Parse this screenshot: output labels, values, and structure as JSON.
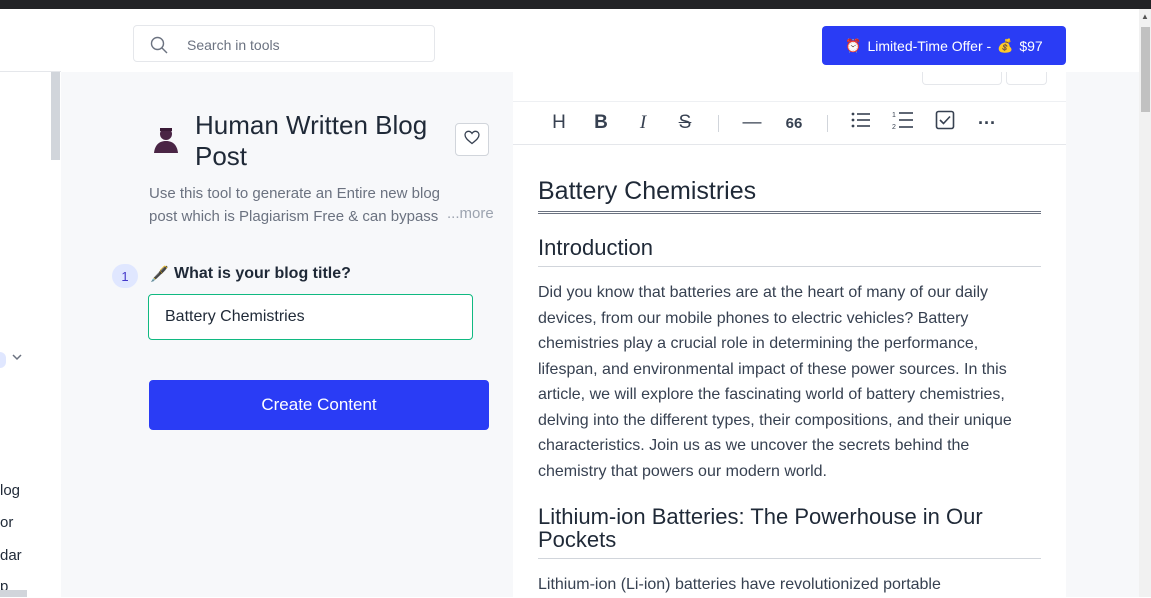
{
  "header": {
    "search_placeholder": "Search in tools",
    "offer_label": "Limited-Time Offer -",
    "offer_price": "$97",
    "offer_icon_alarm": "⏰",
    "offer_icon_moneybag": "💰"
  },
  "sidebar": {
    "partial_items": [
      "log",
      "or",
      "dar",
      "p"
    ]
  },
  "tool": {
    "title": "Human Written Blog Post",
    "description": "Use this tool to generate an Entire new blog post which is Plagiarism Free & can bypass",
    "more_label": "...more"
  },
  "form": {
    "step_number": "1",
    "step_icon": "🖋️",
    "step_label": "What is your blog title?",
    "title_value": "Battery Chemistries",
    "create_button": "Create Content"
  },
  "editor": {
    "toolbar": [
      "heading",
      "bold",
      "italic",
      "strikethrough",
      "horizontal-rule",
      "blockquote",
      "bullet-list",
      "numbered-list",
      "checklist",
      "more"
    ],
    "toolbar_glyphs": {
      "heading": "H",
      "bold": "B",
      "italic": "I",
      "strikethrough": "S",
      "horizontal_rule": "—",
      "blockquote": "66",
      "more": "···"
    },
    "doc_title": "Battery Chemistries",
    "section1_heading": "Introduction",
    "section1_text": "Did you know that batteries are at the heart of many of our daily devices, from our mobile phones to electric vehicles? Battery chemistries play a crucial role in determining the performance, lifespan, and environmental impact of these power sources. In this article, we will explore the fascinating world of battery chemistries, delving into the different types, their compositions, and their unique characteristics. Join us as we uncover the secrets behind the chemistry that powers our modern world.",
    "section2_heading": "Lithium-ion Batteries: The Powerhouse in Our Pockets",
    "section2_text": "Lithium-ion (Li-ion) batteries have revolutionized portable"
  },
  "colors": {
    "primary": "#2a3cf5",
    "input_border": "#10b981",
    "panel_bg": "#f7f8fa"
  }
}
